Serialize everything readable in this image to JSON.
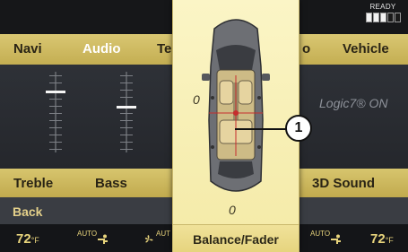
{
  "status": {
    "ready_label": "READY",
    "ready_bars_filled": 3,
    "ready_bars_total": 5
  },
  "nav": {
    "navi": "Navi",
    "audio": "Audio",
    "te_partial": "Te",
    "o_partial": "o",
    "vehicle": "Vehicle"
  },
  "audio_view": {
    "logic7": "Logic7® ON"
  },
  "functions": {
    "treble": "Treble",
    "bass": "Bass",
    "sound3d": "3D Sound",
    "back": "Back"
  },
  "climate": {
    "left_temp": "72",
    "right_temp": "72",
    "unit": "°F",
    "auto_left": "AUTO",
    "auto_fan": "AUT",
    "auto_right": "AUTO"
  },
  "overlay": {
    "title": "Balance/Fader",
    "balance_value": "0",
    "fader_value": "0"
  },
  "callout": {
    "number": "1"
  },
  "colors": {
    "accent_gold": "#d9c772",
    "overlay_bg": "#fbf5c6",
    "text_gold": "#e8d47c"
  }
}
